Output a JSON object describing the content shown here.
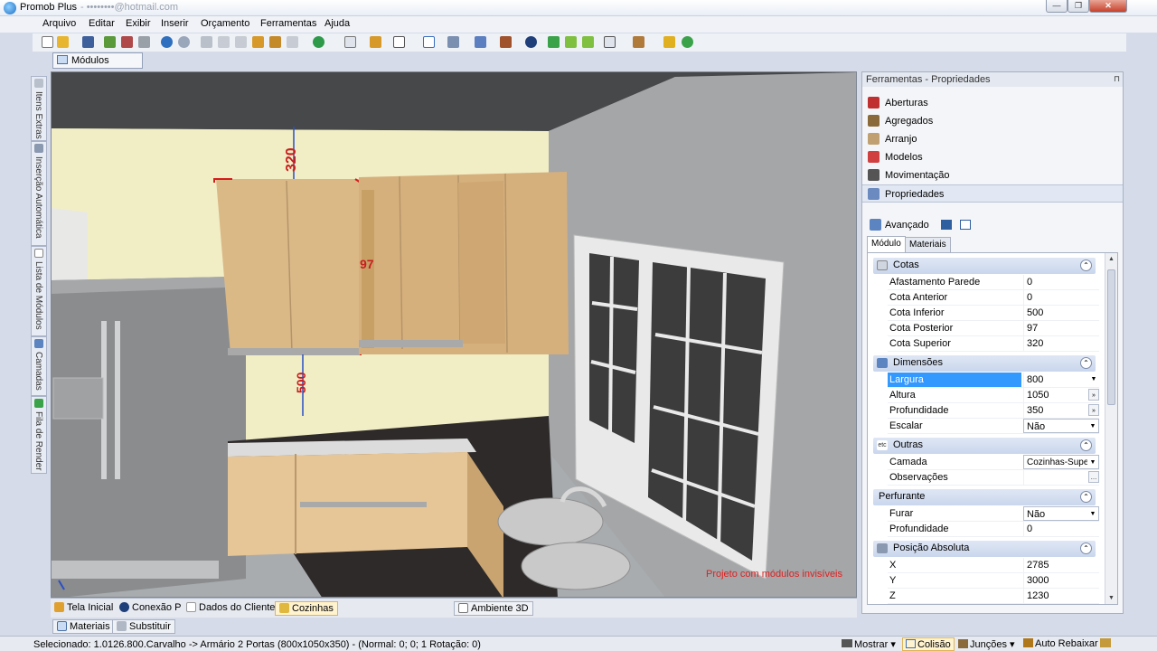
{
  "window": {
    "title": "Promob Plus",
    "title_suffix": "- ••••••••@hotmail.com",
    "min_glyph": "—",
    "max_glyph": "❐",
    "close_glyph": "✕"
  },
  "menu": [
    "Arquivo",
    "Editar",
    "Exibir",
    "Inserir",
    "Orçamento",
    "Ferramentas",
    "Ajuda"
  ],
  "top_tab": {
    "label": "Módulos"
  },
  "left_tabs": [
    {
      "label": "Itens Extras"
    },
    {
      "label": "Inserção Automática"
    },
    {
      "label": "Lista de Módulos"
    },
    {
      "label": "Camadas"
    },
    {
      "label": "Fila de Render"
    }
  ],
  "scene": {
    "dim_top": "320",
    "dim_mid": "97",
    "dim_bottom": "500",
    "watermark": "Projeto com módulos invisíveis",
    "close_glyph": "×"
  },
  "bottom_tabs": {
    "tela_inicial": "Tela Inicial",
    "conexao": "Conexão P",
    "dados_cliente": "Dados do Cliente",
    "cozinhas": "Cozinhas",
    "ambiente": "Ambiente 3D"
  },
  "sub_tabs": {
    "materiais": "Materiais",
    "substituir": "Substituir"
  },
  "status": {
    "text": "Selecionado: 1.0126.800.Carvalho -> Armário 2 Portas (800x1050x350) - (Normal: 0; 0; 1 Rotação: 0)",
    "mostrar": "Mostrar",
    "colisao": "Colisão",
    "juncoes": "Junções",
    "auto_rebaixar": "Auto Rebaixar"
  },
  "panel": {
    "header": "Ferramentas - Propriedades",
    "pin_glyph": "⊓",
    "tools": [
      {
        "label": "Aberturas"
      },
      {
        "label": "Agregados"
      },
      {
        "label": "Arranjo"
      },
      {
        "label": "Modelos"
      },
      {
        "label": "Movimentação"
      },
      {
        "label": "Propriedades"
      }
    ],
    "advanced": "Avançado",
    "tabs": [
      "Módulo",
      "Materiais"
    ],
    "sections": {
      "cotas": "Cotas",
      "dimensoes": "Dimensões",
      "outras": "Outras",
      "outras_icon": "etc",
      "perfurante": "Perfurante",
      "posicao": "Posição Absoluta"
    },
    "cotas_rows": [
      {
        "label": "Afastamento Parede",
        "value": "0"
      },
      {
        "label": "Cota Anterior",
        "value": "0"
      },
      {
        "label": "Cota Inferior",
        "value": "500"
      },
      {
        "label": "Cota Posterior",
        "value": "97"
      },
      {
        "label": "Cota Superior",
        "value": "320"
      }
    ],
    "dim_rows": [
      {
        "label": "Largura",
        "value": "800"
      },
      {
        "label": "Altura",
        "value": "1050"
      },
      {
        "label": "Profundidade",
        "value": "350"
      },
      {
        "label": "Escalar",
        "value": "Não"
      }
    ],
    "outras_rows": [
      {
        "label": "Camada",
        "value": "Cozinhas-Superi"
      },
      {
        "label": "Observações",
        "value": ""
      }
    ],
    "perf_rows": [
      {
        "label": "Furar",
        "value": "Não"
      },
      {
        "label": "Profundidade",
        "value": "0"
      }
    ],
    "pos_rows": [
      {
        "label": "X",
        "value": "2785"
      },
      {
        "label": "Y",
        "value": "3000"
      },
      {
        "label": "Z",
        "value": "1230"
      }
    ]
  }
}
